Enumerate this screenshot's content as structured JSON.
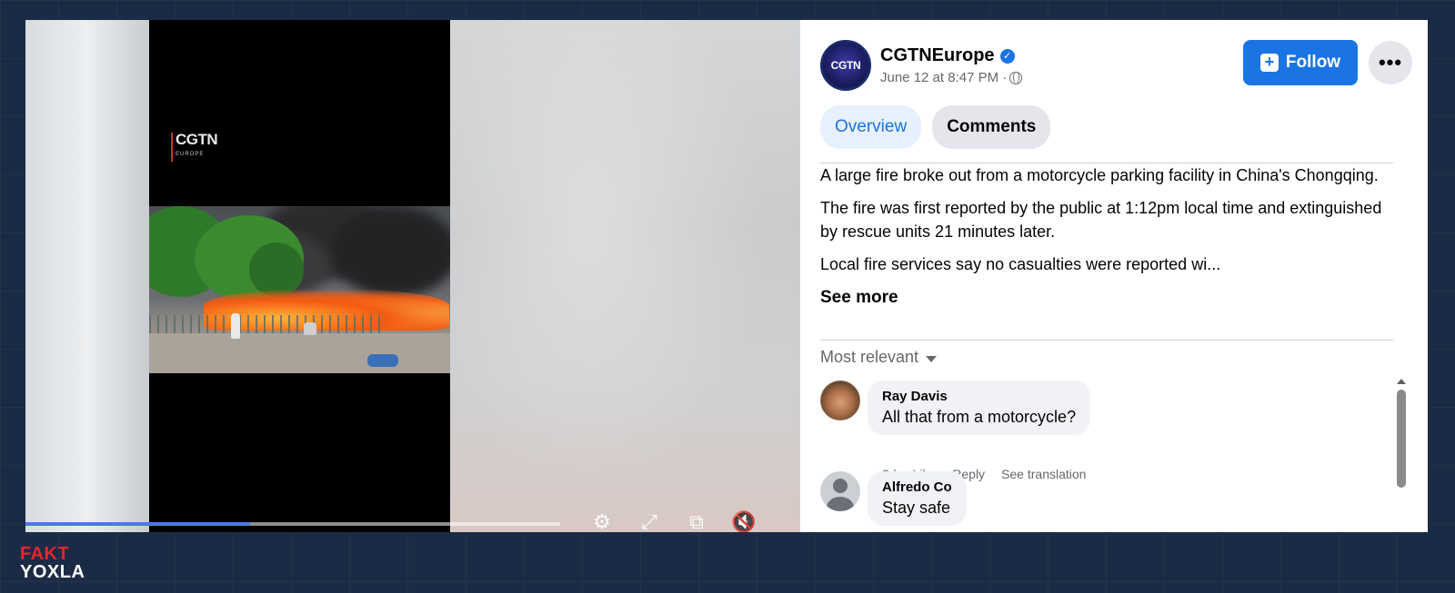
{
  "video": {
    "overlay_logo": "CGTN",
    "overlay_logo_sub": "EUROPE",
    "progress": 0.42,
    "controls": [
      {
        "name": "settings-icon",
        "glyph": "⚙"
      },
      {
        "name": "fullscreen-icon",
        "glyph": "⤢"
      },
      {
        "name": "pip-icon",
        "glyph": "⧉"
      },
      {
        "name": "mute-icon",
        "glyph": "🔇"
      }
    ]
  },
  "post": {
    "page_name": "CGTNEurope",
    "avatar_text": "CGTN",
    "time": "June 12 at 8:47 PM ·",
    "follow_label": "Follow",
    "more_label": "•••",
    "tabs": [
      {
        "label": "Overview",
        "active": true
      },
      {
        "label": "Comments",
        "active": false
      }
    ],
    "description": [
      "A large fire broke out from a motorcycle parking facility in China's Chongqing.",
      "The fire was first reported by the public at 1:12pm local time and extinguished by rescue units 21 minutes later.",
      "Local fire services say no casualties were reported wi..."
    ],
    "see_more": "See more",
    "sort_label": "Most relevant"
  },
  "comments": [
    {
      "author": "Ray Davis",
      "text": "All that from a motorcycle?",
      "actions": [
        "2d",
        "Like",
        "Reply",
        "See translation"
      ]
    },
    {
      "author": "Alfredo Co",
      "text": "Stay safe"
    }
  ],
  "watermark": {
    "top": "FAKT",
    "bottom": "YOXLA"
  },
  "colors": {
    "accent": "#1b74e4",
    "watermark_red": "#e5262a",
    "background": "#1c2b45"
  }
}
